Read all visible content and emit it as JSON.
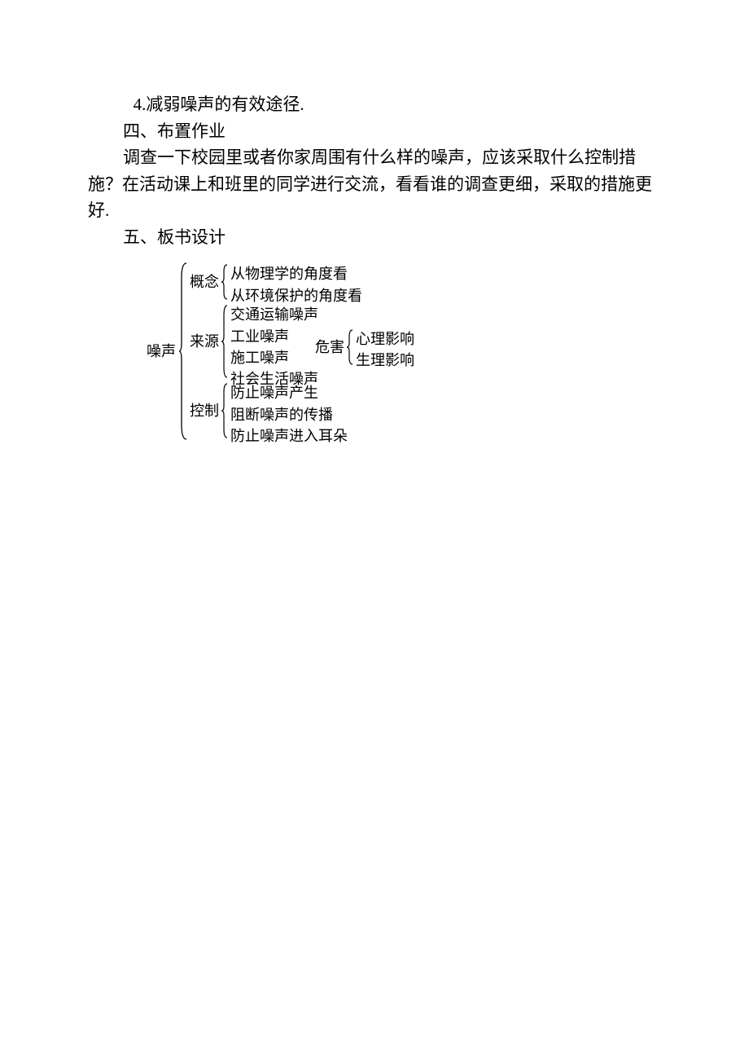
{
  "lines": {
    "l1": "4.减弱噪声的有效途径.",
    "l2": "四、布置作业",
    "l3": "调查一下校园里或者你家周围有什么样的噪声，应该采取什么控制措施？在活动课上和班里的同学进行交流，看看谁的调查更细，采取的措施更好.",
    "l4": "五、板书设计"
  },
  "diagram": {
    "root": "噪声",
    "sections": {
      "concept": {
        "label": "概念",
        "items": [
          "从物理学的角度看",
          "从环境保护的角度看"
        ]
      },
      "source": {
        "label": "来源",
        "items": [
          "交通运输噪声",
          "工业噪声",
          "施工噪声",
          "社会生活噪声"
        ]
      },
      "danger": {
        "label": "危害",
        "items": [
          "心理影响",
          "生理影响"
        ]
      },
      "control": {
        "label": "控制",
        "items": [
          "防止噪声产生",
          "阻断噪声的传播",
          "防止噪声进入耳朵"
        ]
      }
    }
  }
}
